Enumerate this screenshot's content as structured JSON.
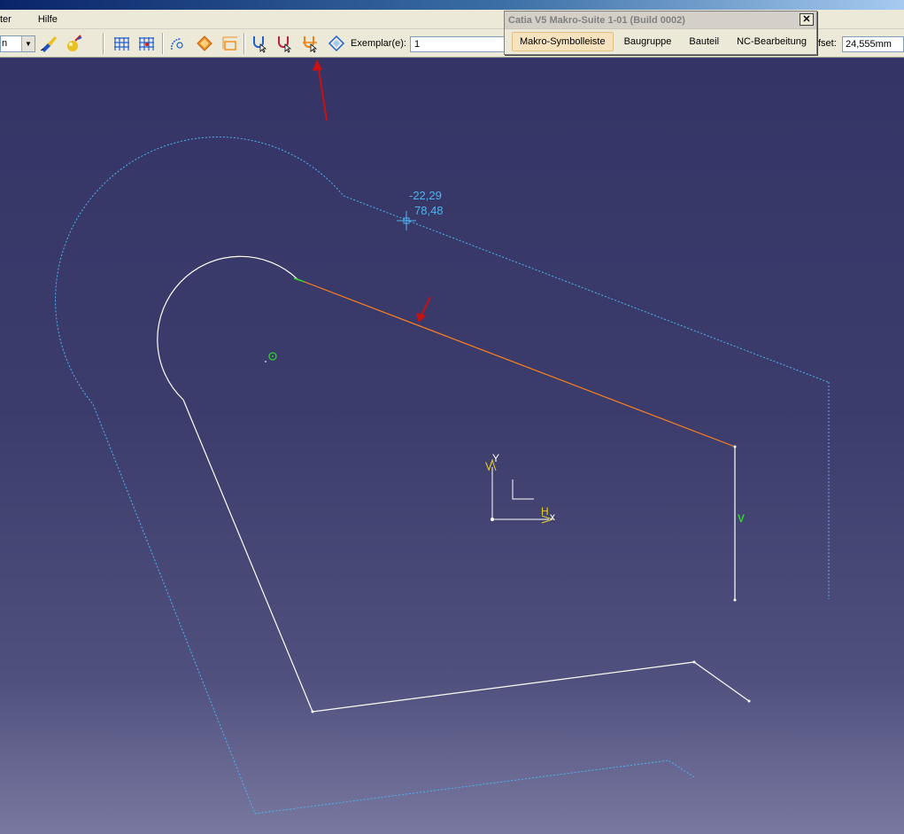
{
  "menubar": {
    "items": [
      {
        "label": "ter"
      },
      {
        "label": "Hilfe"
      }
    ]
  },
  "toolbar": {
    "combo_value": "n",
    "exemplar_label": "Exemplar(e):",
    "exemplar_value": "1",
    "offset_label": "fset:",
    "offset_value": "24,555mm"
  },
  "macro_window": {
    "title": "Catia V5 Makro-Suite 1-01 (Build 0002)",
    "close_glyph": "✕",
    "tabs": [
      {
        "label": "Makro-Symbolleiste",
        "active": true
      },
      {
        "label": "Baugruppe",
        "active": false
      },
      {
        "label": "Bauteil",
        "active": false
      },
      {
        "label": "NC-Bearbeitung",
        "active": false
      }
    ]
  },
  "viewport": {
    "cursor_coords": {
      "x": "-22,29",
      "y": "78,48"
    },
    "axis_labels": {
      "h": "H",
      "x": "x",
      "v": "V",
      "y": "Y"
    },
    "constraint_mark": "V"
  },
  "colors": {
    "profile_line": "#ffffff",
    "offset_line": "#4fb4f0",
    "selected_line": "#ff8020",
    "annotation_arrow": "#cc1010",
    "axis": "#e8d020"
  },
  "icons": [
    "paint-brush-icon",
    "paint-ball-icon",
    "grid-icon",
    "grid-snap-icon",
    "arc-tool-icon",
    "construction-icon",
    "dimension-icon",
    "select-trap-icon",
    "select-trap-red-icon",
    "select-trap-orange-icon",
    "rotate-tool-icon"
  ]
}
